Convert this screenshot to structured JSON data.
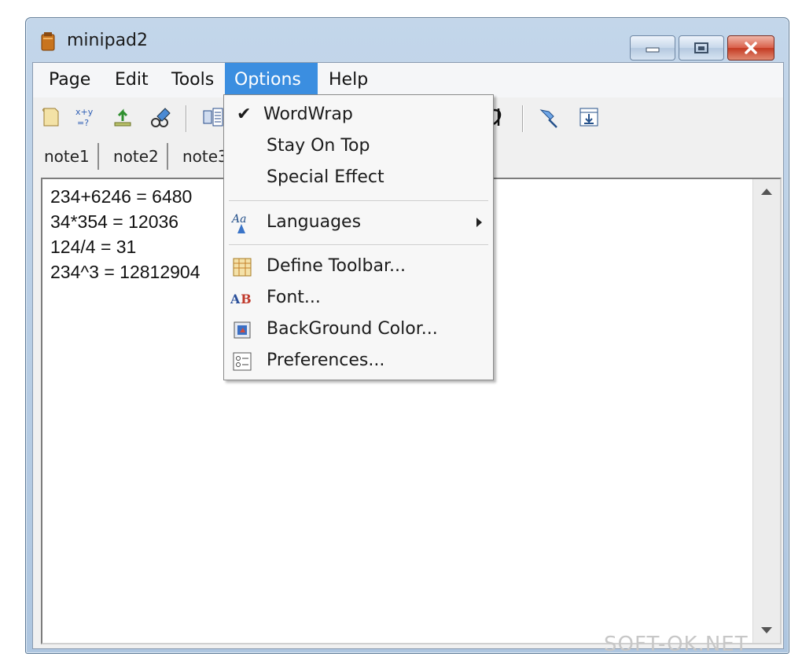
{
  "window": {
    "title": "minipad2"
  },
  "menubar": {
    "items": [
      {
        "label": "Page"
      },
      {
        "label": "Edit"
      },
      {
        "label": "Tools"
      },
      {
        "label": "Options"
      },
      {
        "label": "Help"
      }
    ],
    "active": "Options"
  },
  "tabs": [
    {
      "label": "note1"
    },
    {
      "label": "note2"
    },
    {
      "label": "note3"
    }
  ],
  "editor": {
    "lines": [
      "234+6246 = 6480",
      "34*354 = 12036",
      "124/4 = 31",
      "234^3 = 12812904"
    ]
  },
  "options_menu": {
    "checkmark": "✔",
    "items": [
      {
        "label": "WordWrap",
        "checked": true
      },
      {
        "label": "Stay On Top",
        "checked": false
      },
      {
        "label": "Special Effect",
        "checked": false
      },
      {
        "label": "Languages",
        "submenu": true,
        "icon": "languages-icon"
      },
      {
        "label": "Define Toolbar...",
        "icon": "define-toolbar-icon"
      },
      {
        "label": "Font...",
        "icon": "font-icon"
      },
      {
        "label": "BackGround Color...",
        "icon": "background-color-icon"
      },
      {
        "label": "Preferences...",
        "icon": "preferences-icon"
      }
    ]
  },
  "toolbar": {
    "icons": [
      "new-page-icon",
      "calculator-icon",
      "export-icon",
      "find-icon",
      "columns-icon",
      "special-char-icon",
      "pin-icon",
      "insert-icon"
    ],
    "calc_glyph": "x+y\n=?"
  },
  "watermark": "SOFT-OK.NET",
  "colors": {
    "menu_highlight": "#3b8ee0",
    "close_button": "#c43a22",
    "titlebar": "#b9cfe6"
  }
}
